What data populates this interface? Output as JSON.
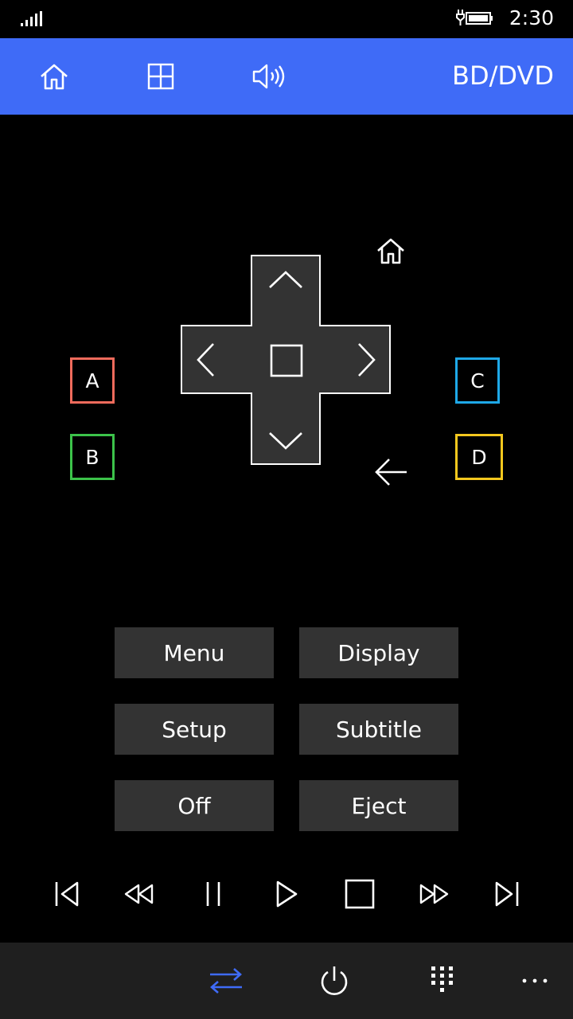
{
  "status_bar": {
    "time": "2:30",
    "signal_icon": "signal-bars-icon",
    "battery_icon": "battery-charging-icon"
  },
  "header": {
    "device_title": "BD/DVD",
    "accent_color": "#3f6bf7",
    "tabs": [
      {
        "icon": "home-icon"
      },
      {
        "icon": "grid-icon"
      },
      {
        "icon": "volume-icon"
      }
    ]
  },
  "navigation": {
    "dpad_icons": [
      "chevron-up-icon",
      "chevron-left-icon",
      "ok-square-icon",
      "chevron-right-icon",
      "chevron-down-icon"
    ],
    "home_icon": "home-icon",
    "back_icon": "back-arrow-icon"
  },
  "color_keys": {
    "a": {
      "label": "A",
      "color": "#f06b5c"
    },
    "b": {
      "label": "B",
      "color": "#3cc34a"
    },
    "c": {
      "label": "C",
      "color": "#1ea8e8"
    },
    "d": {
      "label": "D",
      "color": "#f5c81e"
    }
  },
  "function_buttons": {
    "menu": "Menu",
    "display": "Display",
    "setup": "Setup",
    "subtitle": "Subtitle",
    "off": "Off",
    "eject": "Eject"
  },
  "transport": [
    "skip-previous-icon",
    "rewind-icon",
    "pause-icon",
    "play-icon",
    "stop-icon",
    "fast-forward-icon",
    "skip-next-icon"
  ],
  "app_bar": {
    "icons": [
      "switch-icon",
      "power-icon",
      "keypad-icon",
      "more-icon"
    ],
    "active_color": "#3f6bf7"
  }
}
